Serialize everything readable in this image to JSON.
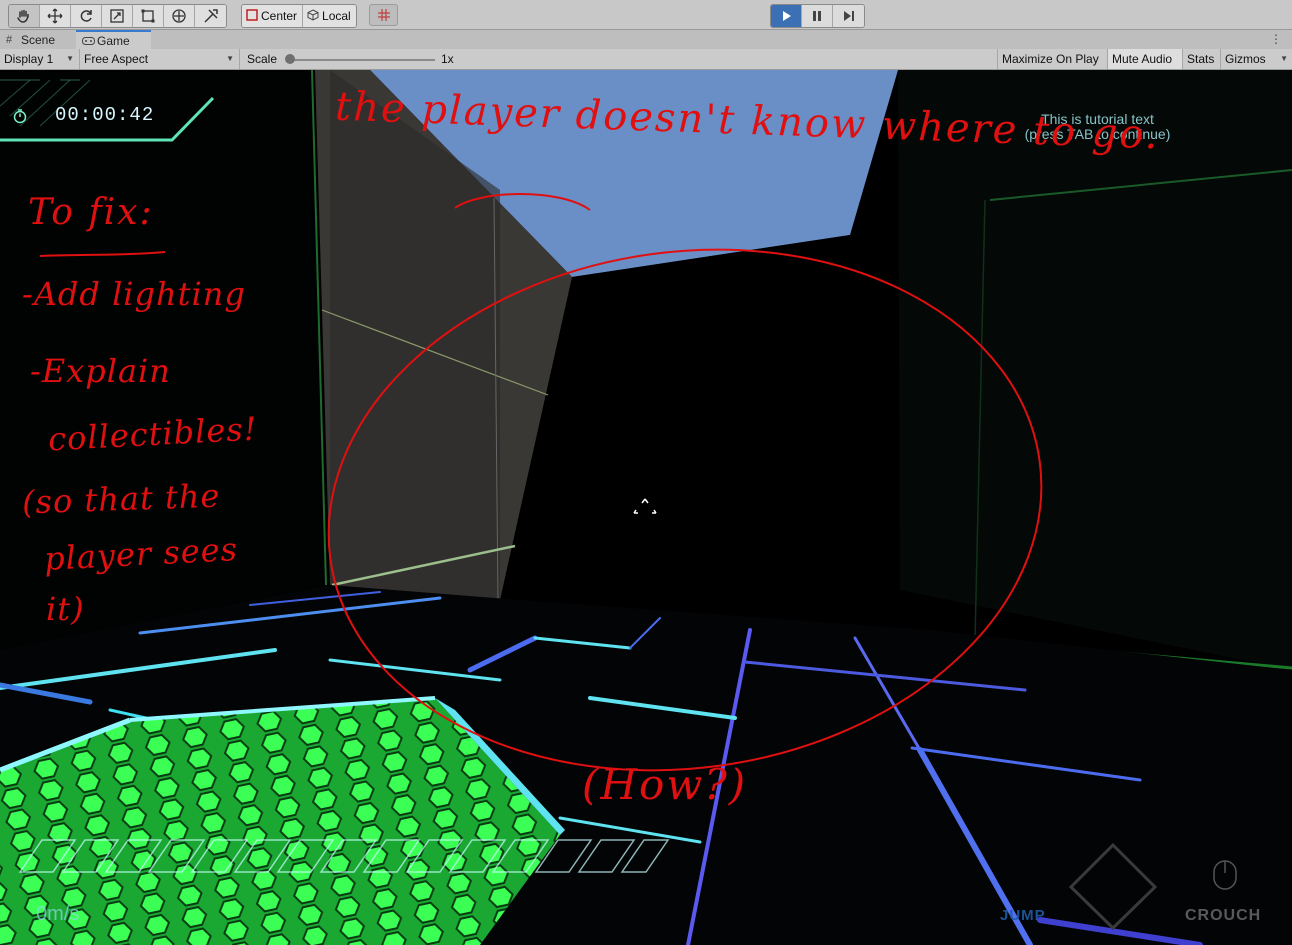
{
  "toolbar": {
    "tools": [
      "hand-tool",
      "move-tool",
      "rotate-tool",
      "scale-tool",
      "rect-tool",
      "transform-tool",
      "custom-tool"
    ],
    "pivot_center_label": "Center",
    "pivot_local_label": "Local",
    "playback": {
      "play_active": true
    }
  },
  "tabs": {
    "scene_label": "Scene",
    "game_label": "Game"
  },
  "gamebar": {
    "display_label": "Display 1",
    "aspect_label": "Free Aspect",
    "scale_label": "Scale",
    "scale_value": "1x",
    "scale_fraction": 0.0,
    "maximize_label": "Maximize On Play",
    "mute_label": "Mute Audio",
    "stats_label": "Stats",
    "gizmos_label": "Gizmos"
  },
  "game": {
    "timer": "00:00:42",
    "tutorial_line1": "This is tutorial text",
    "tutorial_line2": "(press TAB to continue)",
    "speed": "0m/s",
    "jump_label": "JUMP",
    "crouch_label": "CROUCH"
  },
  "annotations": {
    "title": "the player doesn't know where to go.",
    "fix_heading": "To fix:",
    "line1": "-Add lighting",
    "line2": "-Explain",
    "line3": "collectibles!",
    "line4": "(so that the",
    "line5": "player sees",
    "line6": "it)",
    "how": "(How?)"
  },
  "colors": {
    "annotation": "#e01010",
    "accent": "#3d6fb5",
    "sky": "#6a8fc7",
    "neon": "#33ff55"
  }
}
